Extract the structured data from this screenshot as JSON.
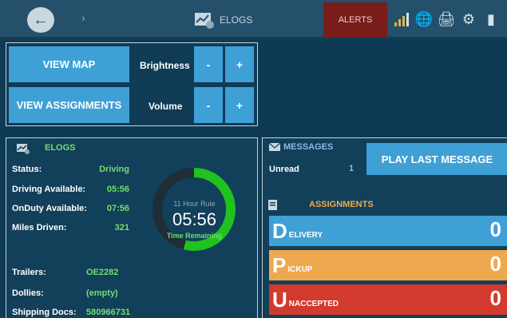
{
  "topbar": {
    "back_icon": "arrow-left-icon",
    "elogs_label": "ELOGS",
    "alerts_label": "ALERTS",
    "icons": [
      "signal-icon",
      "globe-icon",
      "printer-icon",
      "settings-gear-icon",
      "battery-icon"
    ],
    "colors": {
      "alerts_bg": "#7a1c1a",
      "accent": "#3fa0d6",
      "green": "#6fe06a",
      "orange": "#f0a84e"
    }
  },
  "controls": {
    "view_map": "VIEW MAP",
    "view_assignments": "VIEW ASSIGNMENTS",
    "brightness_label": "Brightness",
    "volume_label": "Volume",
    "minus": "-",
    "plus": "+"
  },
  "elogs": {
    "title": "ELOGS",
    "status_label": "Status:",
    "status_value": "Driving",
    "driving_available_label": "Driving Available:",
    "driving_available_value": "05:56",
    "onduty_available_label": "OnDuty Available:",
    "onduty_available_value": "07:56",
    "miles_driven_label": "Miles Driven:",
    "miles_driven_value": "321",
    "rule_label": "11 Hour Rule",
    "time_remaining": "05:56",
    "time_remaining_label": "Time Remaining",
    "remaining_fraction": 0.54,
    "trailers_label": "Trailers:",
    "trailers_value": "OE2282",
    "dollies_label": "Dollies:",
    "dollies_value": "(empty)",
    "shipping_docs_label": "Shipping Docs:",
    "shipping_docs_value": "580966731"
  },
  "messages": {
    "title": "MESSAGES",
    "unread_label": "Unread",
    "unread_count": "1",
    "play_last": "PLAY LAST MESSAGE"
  },
  "assignments": {
    "title": "ASSIGNMENTS",
    "items": [
      {
        "letter": "D",
        "rest": "ELIVERY",
        "count": "0",
        "color": "#3fa0d6"
      },
      {
        "letter": "P",
        "rest": "ICKUP",
        "count": "0",
        "color": "#f0a84e"
      },
      {
        "letter": "U",
        "rest": "NACCEPTED",
        "count": "0",
        "color": "#d23a2e"
      }
    ]
  }
}
